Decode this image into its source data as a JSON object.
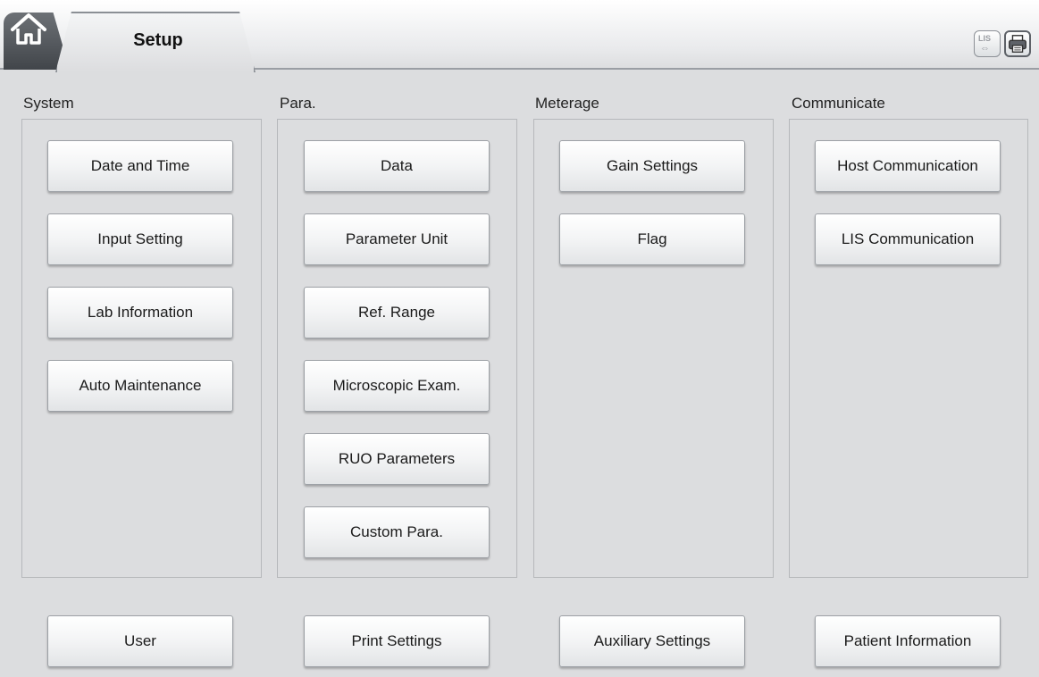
{
  "tabs": {
    "setup_label": "Setup"
  },
  "toolbar": {
    "lis_label": "LIS",
    "lis_arrow": "⇔"
  },
  "sections": {
    "system": {
      "title": "System",
      "buttons": [
        "Date and Time",
        "Input Setting",
        "Lab Information",
        "Auto Maintenance"
      ]
    },
    "para": {
      "title": "Para.",
      "buttons": [
        "Data",
        "Parameter Unit",
        "Ref. Range",
        "Microscopic Exam.",
        "RUO Parameters",
        "Custom Para."
      ]
    },
    "meterage": {
      "title": "Meterage",
      "buttons": [
        "Gain Settings",
        "Flag"
      ]
    },
    "communicate": {
      "title": "Communicate",
      "buttons": [
        "Host Communication",
        "LIS Communication"
      ]
    }
  },
  "bottom_buttons": [
    "User",
    "Print Settings",
    "Auxiliary Settings",
    "Patient Information"
  ],
  "colors": {
    "background": "#dcdddf",
    "tab_dark": "#41454a",
    "button_border": "#9ca0a5"
  }
}
